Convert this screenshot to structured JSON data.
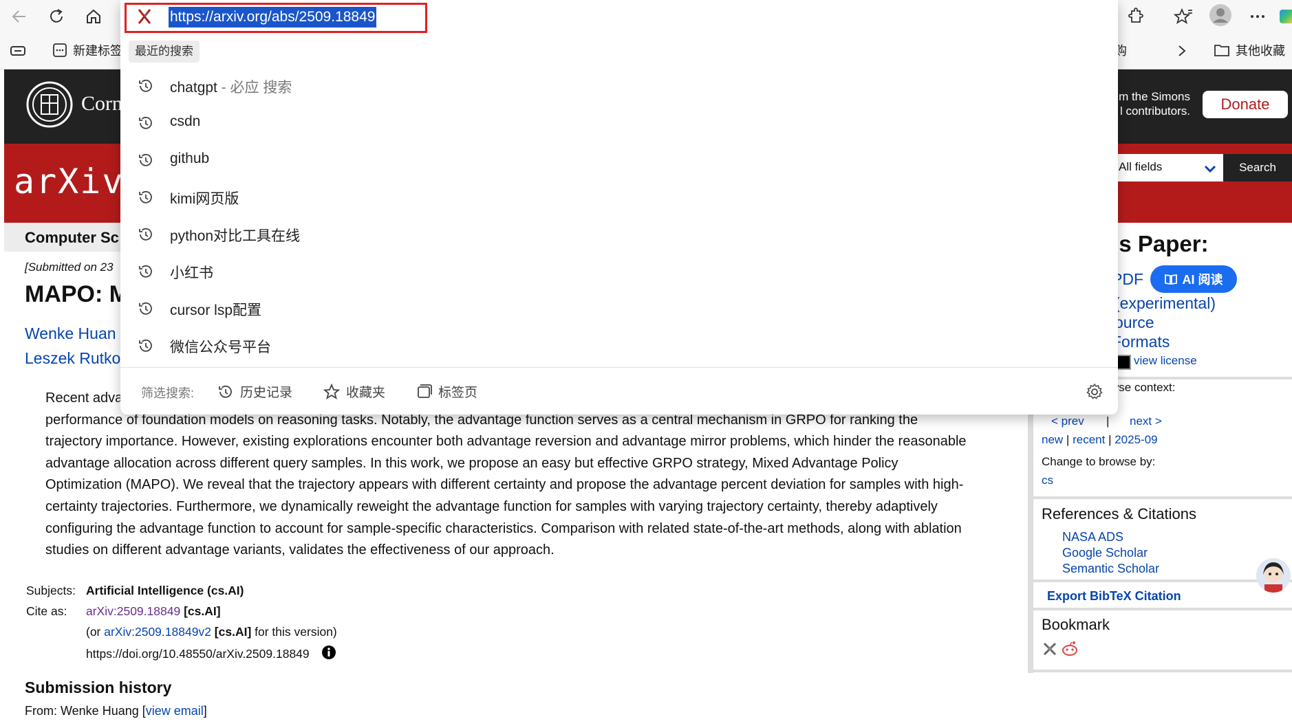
{
  "browser": {
    "address_url": "https://arxiv.org/abs/2509.18849",
    "bookmarks": {
      "new_tab_label": "新建标签",
      "partial_item": "购",
      "other_favorites": "其他收藏"
    }
  },
  "dropdown": {
    "recent_label": "最近的搜索",
    "history": [
      {
        "text": "chatgpt",
        "suffix": " - 必应 搜索"
      },
      {
        "text": "csdn",
        "suffix": ""
      },
      {
        "text": "github",
        "suffix": ""
      },
      {
        "text": "kimi网页版",
        "suffix": ""
      },
      {
        "text": "python对比工具在线",
        "suffix": ""
      },
      {
        "text": "小红书",
        "suffix": ""
      },
      {
        "text": "cursor lsp配置",
        "suffix": ""
      },
      {
        "text": "微信公众号平台",
        "suffix": ""
      }
    ],
    "filter_label": "筛选搜索:",
    "filters": {
      "history": "历史记录",
      "favorites": "收藏夹",
      "tabs": "标签页"
    }
  },
  "arxiv": {
    "cornell_text": "Corn",
    "simons_line1": "m the Simons",
    "simons_line2": "l contributors.",
    "donate": "Donate",
    "logo_text": "arXiv",
    "search_field": "All fields",
    "search_button": "Search",
    "category_bar": "Computer Sc",
    "submitted": "[Submitted on 23",
    "title": "MAPO: M",
    "authors_line1": "Wenke Huan",
    "authors_line2": "Leszek Rutko",
    "abstract_first": "Recent adva",
    "abstract_rest": [
      "performance of foundation models on reasoning tasks. Notably, the advantage function serves as a central mechanism in GRPO for ranking the",
      "trajectory importance. However, existing explorations encounter both advantage reversion and advantage mirror problems, which hinder the reasonable",
      "advantage allocation across different query samples. In this work, we propose an easy but effective GRPO strategy, Mixed Advantage Policy",
      "Optimization (MAPO). We reveal that the trajectory appears with different certainty and propose the advantage percent deviation for samples with high-",
      "certainty trajectories. Furthermore, we dynamically reweight the advantage function for samples with varying trajectory certainty, thereby adaptively",
      "configuring the advantage function to account for sample-specific characteristics. Comparison with related state-of-the-art methods, along with ablation",
      "studies on different advantage variants, validates the effectiveness of our approach."
    ],
    "subjects_label": "Subjects:",
    "subjects_value": "Artificial Intelligence (cs.AI)",
    "cite_label": "Cite as:",
    "cite_link": "arXiv:2509.18849",
    "cite_cat": "[cs.AI]",
    "cite2_pre": "(or ",
    "cite2_link": "arXiv:2509.18849v2",
    "cite2_cat": "[cs.AI]",
    "cite2_post": " for this version)",
    "doi": "https://doi.org/10.48550/arXiv.2509.18849",
    "history_heading": "Submission history",
    "from_text": "From: Wenke Huang [",
    "view_email": "view email",
    "from_close": "]"
  },
  "sidebar": {
    "access_heading": "ss Paper:",
    "pdf": "PDF",
    "ai_read": "AI 阅读",
    "experimental": "(experimental)",
    "source": "ource",
    "formats": "Formats",
    "view_license": "view license",
    "browse_context": "wse context:",
    "prev": "< prev",
    "sep": "|",
    "next": "next >",
    "new": "new",
    "recent": "recent",
    "date": "2025-09",
    "change_browse": "Change to browse by:",
    "cs": "cs",
    "refs_heading": "References & Citations",
    "refs": [
      "NASA ADS",
      "Google Scholar",
      "Semantic Scholar"
    ],
    "export_bibtex": "Export BibTeX Citation",
    "bookmark_heading": "Bookmark"
  }
}
